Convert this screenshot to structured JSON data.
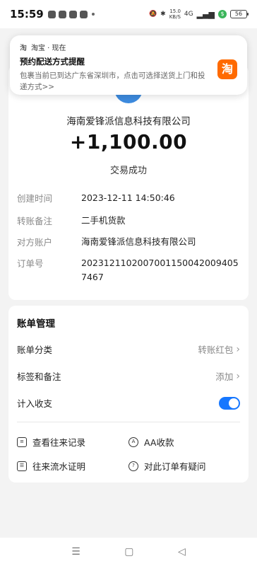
{
  "status_bar": {
    "time": "15:59",
    "speed_top": "15.0",
    "speed_bottom": "KB/S",
    "network": "4G",
    "battery": "56"
  },
  "notification": {
    "app": "淘宝 · 现在",
    "title": "预约配送方式提醒",
    "body": "包裹当前已到达广东省深圳市，点击可选择送货上门和投递方式>>",
    "app_icon_text": "淘"
  },
  "transaction": {
    "merchant": "海南爱锋派信息科技有限公司",
    "amount": "+1,100.00",
    "status": "交易成功",
    "details": [
      {
        "label": "创建时间",
        "value": "2023-12-11 14:50:46"
      },
      {
        "label": "转账备注",
        "value": "二手机货款"
      },
      {
        "label": "对方账户",
        "value": "海南爱锋派信息科技有限公司"
      },
      {
        "label": "订单号",
        "value": "20231211020070011500420094057467"
      }
    ]
  },
  "bill": {
    "title": "账单管理",
    "category_label": "账单分类",
    "category_value": "转账红包",
    "tags_label": "标签和备注",
    "tags_value": "添加",
    "income_label": "计入收支",
    "actions": {
      "history": "查看往来记录",
      "aa": "AA收款",
      "statement": "往来流水证明",
      "question": "对此订单有疑问"
    }
  },
  "colors": {
    "accent": "#1677ff",
    "avatar": "#3d8bdf",
    "taobao": "#ff6a00"
  }
}
